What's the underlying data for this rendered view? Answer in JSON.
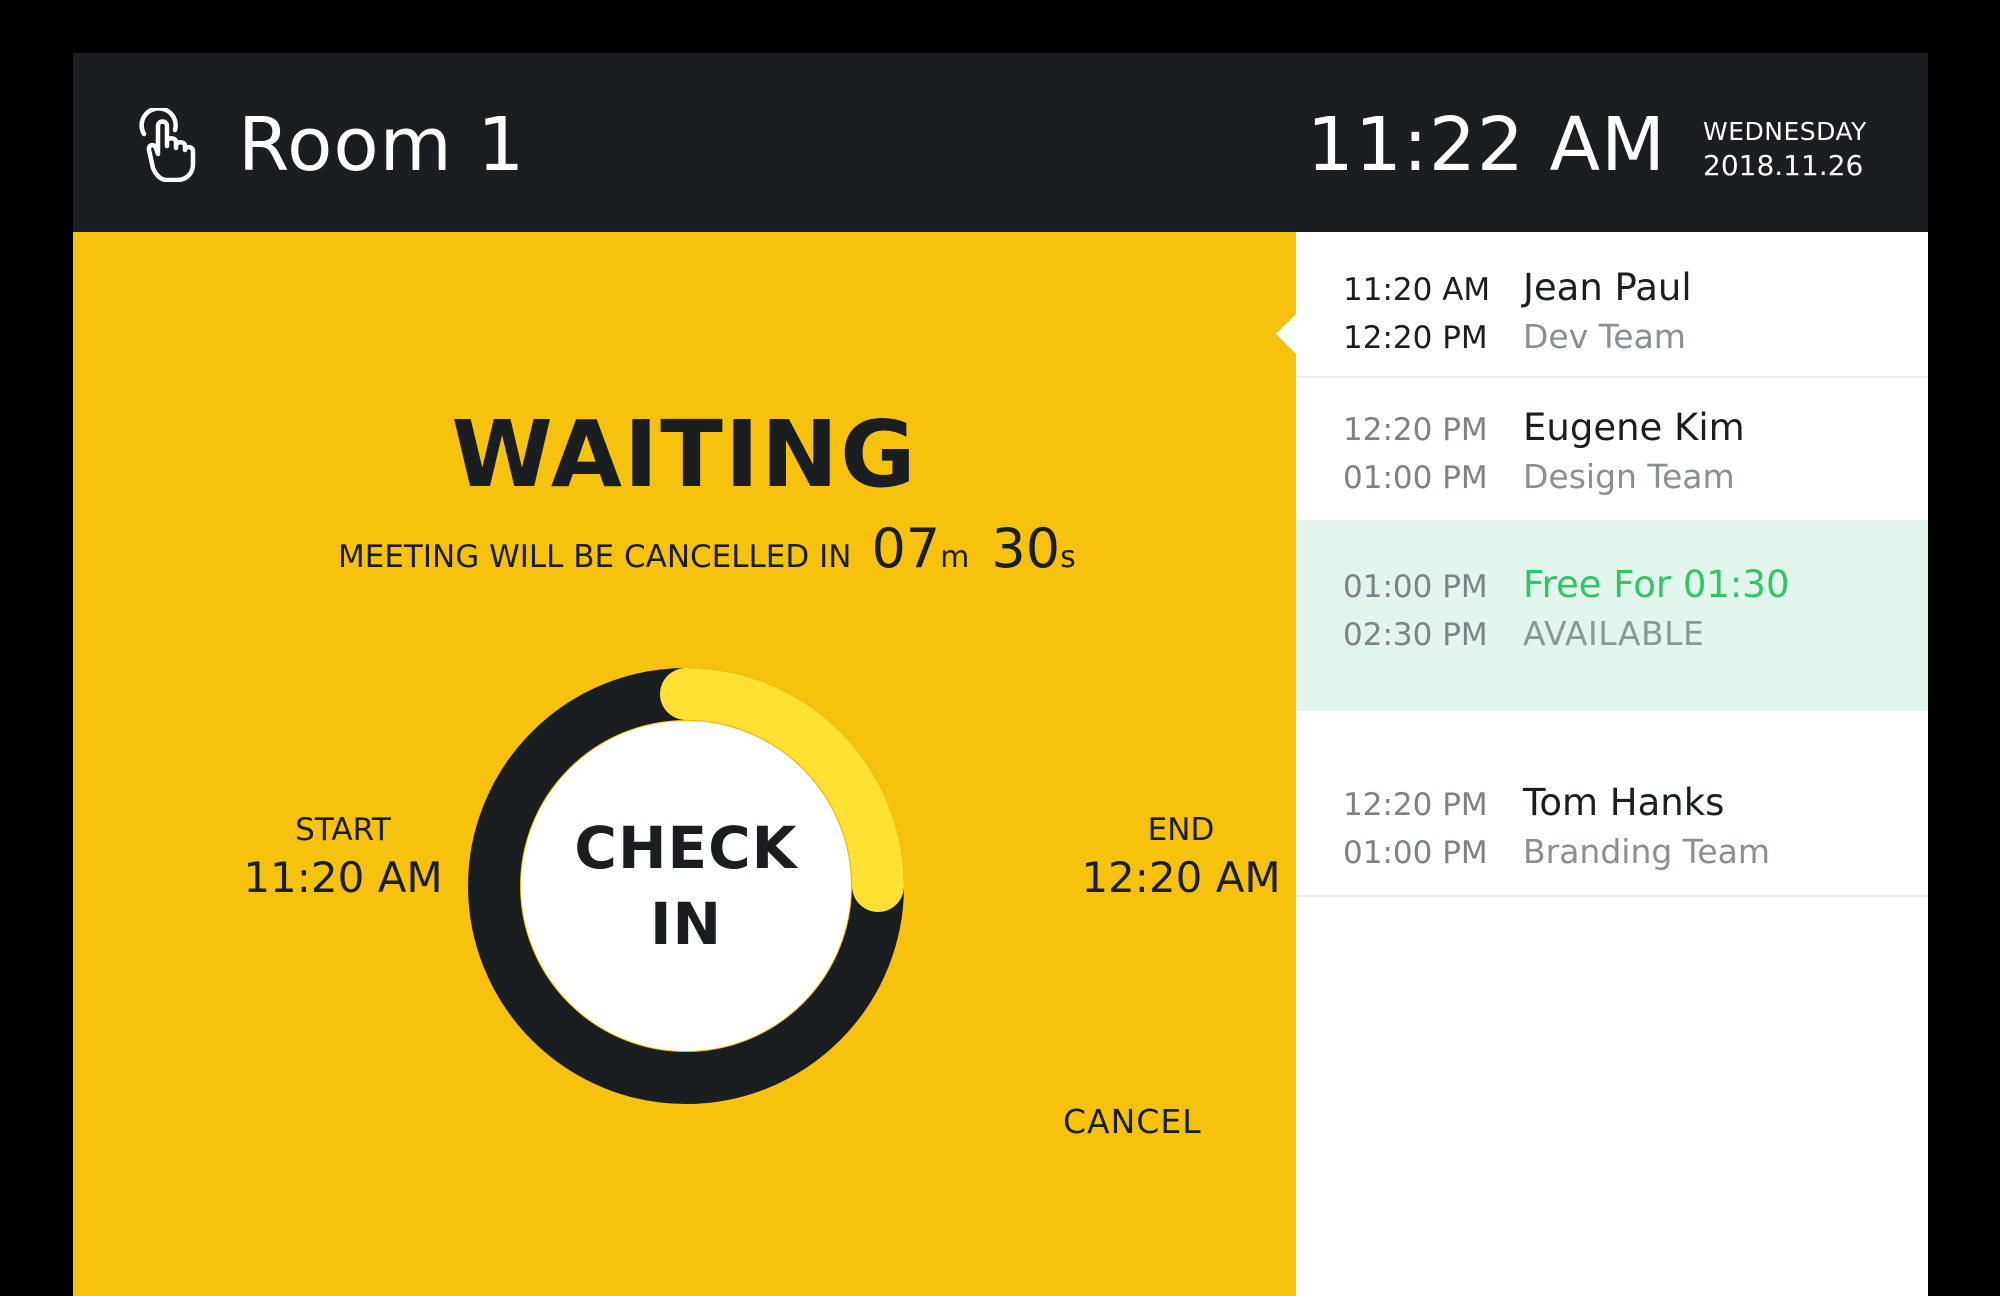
{
  "header": {
    "room_name": "Room 1",
    "time": "11:22 AM",
    "weekday": "WEDNESDAY",
    "date": "2018.11.26",
    "icon": "touch-hand-icon"
  },
  "status": {
    "title": "WAITING",
    "countdown_label": "MEETING WILL BE CANCELLED IN",
    "minutes": "07",
    "minutes_unit": "m",
    "seconds": "30",
    "seconds_unit": "s",
    "progress_fraction": 0.25
  },
  "meeting": {
    "start_label": "START",
    "start_time": "11:20 AM",
    "end_label": "END",
    "end_time": "12:20 AM"
  },
  "actions": {
    "check_in_label": "CHECK\nIN",
    "cancel_label": "CANCEL"
  },
  "schedule": [
    {
      "start": "11:20 AM",
      "end": "12:20 PM",
      "name": "Jean Paul",
      "team": "Dev Team",
      "state": "current"
    },
    {
      "start": "12:20 PM",
      "end": "01:00 PM",
      "name": "Eugene Kim",
      "team": "Design Team",
      "state": "booked"
    },
    {
      "start": "01:00 PM",
      "end": "02:30 PM",
      "name": "Free For 01:30",
      "team": "AVAILABLE",
      "state": "available"
    },
    {
      "start": "12:20 PM",
      "end": "01:00 PM",
      "name": "Tom Hanks",
      "team": "Branding Team",
      "state": "booked"
    }
  ],
  "colors": {
    "header_bg": "#1a1e20",
    "accent_yellow": "#f7c20e",
    "progress_yellow": "#ffe033",
    "ring_dark": "#1a1e20",
    "available_green": "#2fc766",
    "available_bg": "#e3f6ee"
  }
}
